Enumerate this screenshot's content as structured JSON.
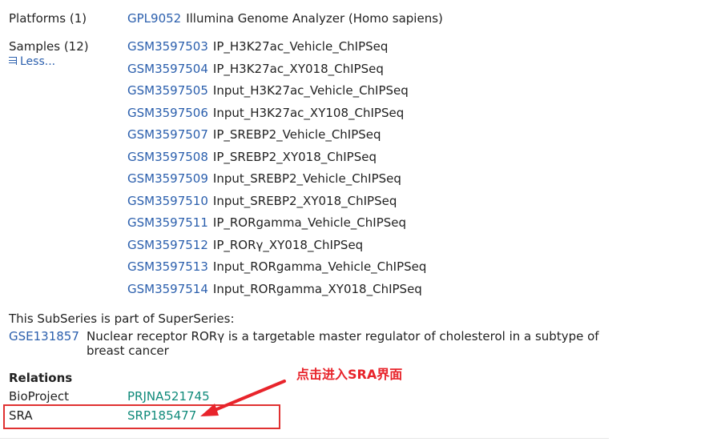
{
  "platforms": {
    "label": "Platforms (1)",
    "items": [
      {
        "accession": "GPL9052",
        "title": "Illumina Genome Analyzer (Homo sapiens)"
      }
    ]
  },
  "samples": {
    "label": "Samples (12)",
    "toggle_label": "Less...",
    "items": [
      {
        "accession": "GSM3597503",
        "title": "IP_H3K27ac_Vehicle_ChIPSeq"
      },
      {
        "accession": "GSM3597504",
        "title": "IP_H3K27ac_XY018_ChIPSeq"
      },
      {
        "accession": "GSM3597505",
        "title": "Input_H3K27ac_Vehicle_ChIPSeq"
      },
      {
        "accession": "GSM3597506",
        "title": "Input_H3K27ac_XY108_ChIPSeq"
      },
      {
        "accession": "GSM3597507",
        "title": "IP_SREBP2_Vehicle_ChIPSeq"
      },
      {
        "accession": "GSM3597508",
        "title": "IP_SREBP2_XY018_ChIPSeq"
      },
      {
        "accession": "GSM3597509",
        "title": "Input_SREBP2_Vehicle_ChIPSeq"
      },
      {
        "accession": "GSM3597510",
        "title": "Input_SREBP2_XY018_ChIPSeq"
      },
      {
        "accession": "GSM3597511",
        "title": "IP_RORgamma_Vehicle_ChIPSeq"
      },
      {
        "accession": "GSM3597512",
        "title": "IP_RORγ_XY018_ChIPSeq"
      },
      {
        "accession": "GSM3597513",
        "title": "Input_RORgamma_Vehicle_ChIPSeq"
      },
      {
        "accession": "GSM3597514",
        "title": "Input_RORgamma_XY018_ChIPSeq"
      }
    ]
  },
  "superseries": {
    "intro": "This SubSeries is part of SuperSeries:",
    "accession": "GSE131857",
    "description": "Nuclear receptor RORγ is a targetable master regulator of cholesterol in a subtype of breast cancer"
  },
  "relations": {
    "heading": "Relations",
    "bioproject_label": "BioProject",
    "bioproject_value": "PRJNA521745",
    "sra_label": "SRA",
    "sra_value": "SRP185477"
  },
  "annotation": {
    "text": "点击进入SRA界面",
    "color": "#e8242b"
  },
  "colors": {
    "link": "#2b5fad",
    "link_teal": "#0f8a7a",
    "highlight_border": "#e03131"
  },
  "icons": {
    "less_toggle": "collapse-icon",
    "annotation_arrow": "arrow-icon"
  }
}
